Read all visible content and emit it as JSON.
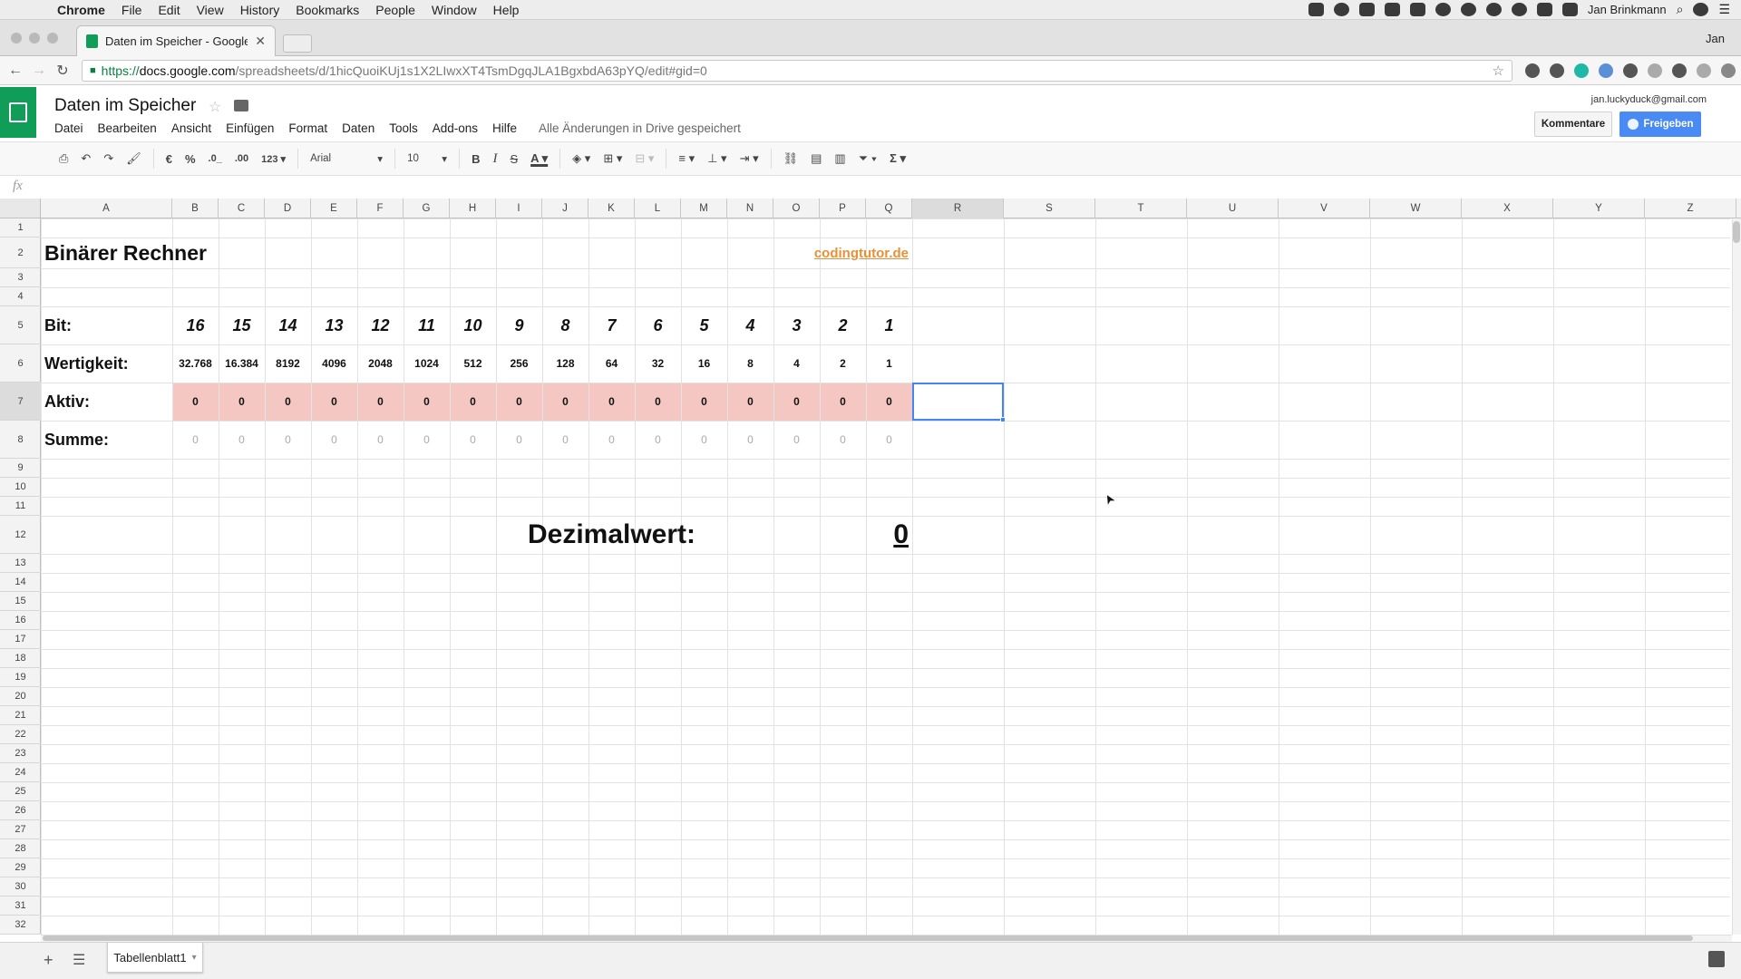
{
  "mac_menu": {
    "apple_icon": "apple-logo-icon",
    "items": [
      "Chrome",
      "File",
      "Edit",
      "View",
      "History",
      "Bookmarks",
      "People",
      "Window",
      "Help"
    ],
    "user": "Jan Brinkmann"
  },
  "browser": {
    "tab_title": "Daten im Speicher - Google Ta",
    "profile": "Jan",
    "url_scheme": "https://",
    "url_host": "docs.google.com",
    "url_path": "/spreadsheets/d/1hicQuoiKUj1s1X2LIwxXT4TsmDgqJLA1BgxbdA63pYQ/edit#gid=0"
  },
  "doc": {
    "title": "Daten im Speicher",
    "menu": [
      "Datei",
      "Bearbeiten",
      "Ansicht",
      "Einfügen",
      "Format",
      "Daten",
      "Tools",
      "Add-ons",
      "Hilfe"
    ],
    "save_status": "Alle Änderungen in Drive gespeichert",
    "account": "jan.luckyduck@gmail.com",
    "comment_label": "Kommentare",
    "share_label": "Freigeben"
  },
  "toolbar": {
    "currency": "€",
    "percent": "%",
    "dec_less": ".0_",
    "dec_more": ".00",
    "format_more": "123",
    "font": "Arial",
    "size": "10",
    "bold": "B",
    "italic": "I",
    "strike": "S",
    "text_color": "A",
    "sum": "Σ"
  },
  "formula_bar": {
    "fx": "fx"
  },
  "colors": {
    "accent": "#0f9d58",
    "share_button": "#4a8af4",
    "aktiv_row_fill": "#f4c7c3",
    "link_orange": "#e69138",
    "selection": "#4285f4"
  },
  "sheet": {
    "columns": [
      "A",
      "B",
      "C",
      "D",
      "E",
      "F",
      "G",
      "H",
      "I",
      "J",
      "K",
      "L",
      "M",
      "N",
      "O",
      "P",
      "Q",
      "R",
      "S",
      "T",
      "U",
      "V",
      "W",
      "X",
      "Y",
      "Z"
    ],
    "selected_column": "R",
    "selected_row": "7",
    "rows": [
      "1",
      "2",
      "3",
      "4",
      "5",
      "6",
      "7",
      "8",
      "9",
      "10",
      "11",
      "12",
      "13",
      "14",
      "15",
      "16",
      "17",
      "18",
      "19",
      "20",
      "21",
      "22",
      "23",
      "24",
      "25",
      "26",
      "27",
      "28",
      "29",
      "30",
      "31",
      "32"
    ],
    "title": "Binärer Rechner",
    "link": "codingtutor.de",
    "labels": {
      "bit": "Bit:",
      "weight": "Wertigkeit:",
      "active": "Aktiv:",
      "sum": "Summe:"
    },
    "bits": [
      "16",
      "15",
      "14",
      "13",
      "12",
      "11",
      "10",
      "9",
      "8",
      "7",
      "6",
      "5",
      "4",
      "3",
      "2",
      "1"
    ],
    "weights": [
      "32.768",
      "16.384",
      "8192",
      "4096",
      "2048",
      "1024",
      "512",
      "256",
      "128",
      "64",
      "32",
      "16",
      "8",
      "4",
      "2",
      "1"
    ],
    "active": [
      "0",
      "0",
      "0",
      "0",
      "0",
      "0",
      "0",
      "0",
      "0",
      "0",
      "0",
      "0",
      "0",
      "0",
      "0",
      "0"
    ],
    "sums": [
      "0",
      "0",
      "0",
      "0",
      "0",
      "0",
      "0",
      "0",
      "0",
      "0",
      "0",
      "0",
      "0",
      "0",
      "0",
      "0"
    ],
    "decimal_label": "Dezimalwert:",
    "decimal_value": "0"
  },
  "sheets_bar": {
    "tab": "Tabellenblatt1",
    "add_icon": "plus-icon",
    "list_icon": "list-icon"
  }
}
